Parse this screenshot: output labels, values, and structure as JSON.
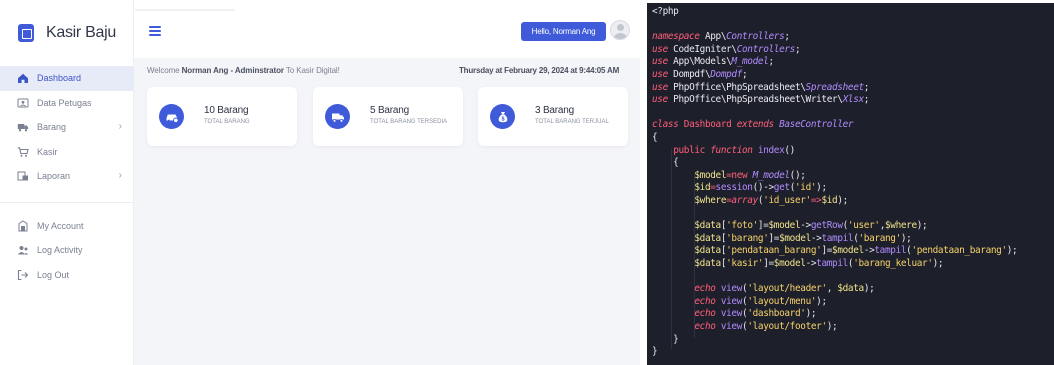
{
  "app": {
    "brand": "Kasir Baju",
    "nav_main": [
      {
        "label": "Dashboard",
        "icon": "home-icon",
        "active": true,
        "has_chevron": false
      },
      {
        "label": "Data Petugas",
        "icon": "users-folder-icon",
        "active": false,
        "has_chevron": false
      },
      {
        "label": "Barang",
        "icon": "truck-icon",
        "active": false,
        "has_chevron": true
      },
      {
        "label": "Kasir",
        "icon": "cart-icon",
        "active": false,
        "has_chevron": false
      },
      {
        "label": "Laporan",
        "icon": "report-icon",
        "active": false,
        "has_chevron": true
      }
    ],
    "nav_account": [
      {
        "label": "My Account",
        "icon": "account-icon"
      },
      {
        "label": "Log Activity",
        "icon": "activity-icon"
      },
      {
        "label": "Log Out",
        "icon": "logout-icon"
      }
    ],
    "chevron": "›",
    "header": {
      "hello": "Hello, Norman Ang"
    },
    "welcome": {
      "prefix": "Welcome ",
      "name": "Norman Ang - Adminstrator",
      "suffix": " To Kasir Digital!"
    },
    "datetime": "Thursday at February 29, 2024 at 9:44:05 AM",
    "cards": [
      {
        "value": "10 Barang",
        "label": "TOTAL BARANG",
        "icon": "car-icon"
      },
      {
        "value": "5 Barang",
        "label": "TOTAL BARANG TERSEDIA",
        "icon": "truck-icon"
      },
      {
        "value": "3 Barang",
        "label": "TOTAL BARANG TERJUAL",
        "icon": "money-bag-icon"
      }
    ],
    "accent_color": "#3f5bd9"
  },
  "code": {
    "colors": {
      "background": "#1d1f2a",
      "keyword": "#ff5f7a",
      "class_ref": "#b28cff",
      "string": "#f7d36b",
      "variable": "#f1e58e",
      "function": "#b28cff",
      "plain": "#e9e9ef"
    },
    "lines": [
      [
        [
          "<?php",
          "plain"
        ]
      ],
      [],
      [
        [
          "namespace",
          "kwi"
        ],
        [
          " App\\",
          "plain"
        ],
        [
          "Controllers",
          "cls"
        ],
        [
          ";",
          "plain"
        ]
      ],
      [
        [
          "use",
          "kwi"
        ],
        [
          " CodeIgniter\\",
          "plain"
        ],
        [
          "Controllers",
          "cls"
        ],
        [
          ";",
          "plain"
        ]
      ],
      [
        [
          "use",
          "kwi"
        ],
        [
          " App\\Models\\",
          "plain"
        ],
        [
          "M_model",
          "cls"
        ],
        [
          ";",
          "plain"
        ]
      ],
      [
        [
          "use",
          "kwi"
        ],
        [
          " Dompdf\\",
          "plain"
        ],
        [
          "Dompdf",
          "cls"
        ],
        [
          ";",
          "plain"
        ]
      ],
      [
        [
          "use",
          "kwi"
        ],
        [
          " PhpOffice\\PhpSpreadsheet\\",
          "plain"
        ],
        [
          "Spreadsheet",
          "cls"
        ],
        [
          ";",
          "plain"
        ]
      ],
      [
        [
          "use",
          "kwi"
        ],
        [
          " PhpOffice\\PhpSpreadsheet\\Writer\\",
          "plain"
        ],
        [
          "Xlsx",
          "cls"
        ],
        [
          ";",
          "plain"
        ]
      ],
      [],
      [
        [
          "class",
          "kwi"
        ],
        [
          " Dashboard ",
          "kw"
        ],
        [
          "extends",
          "kwi"
        ],
        [
          " BaseController",
          "cls"
        ]
      ],
      [
        [
          "{",
          "plain"
        ]
      ],
      [
        [
          "    ",
          "plain"
        ],
        [
          "public",
          "kw"
        ],
        [
          " ",
          "plain"
        ],
        [
          "function",
          "kwi"
        ],
        [
          " index",
          "fn"
        ],
        [
          "()",
          "plain"
        ]
      ],
      [
        [
          "    {",
          "plain"
        ]
      ],
      [
        [
          "        ",
          "plain"
        ],
        [
          "$model",
          "var"
        ],
        [
          "=",
          "op"
        ],
        [
          "new",
          "kw"
        ],
        [
          " ",
          "plain"
        ],
        [
          "M_model",
          "cls"
        ],
        [
          "();",
          "plain"
        ]
      ],
      [
        [
          "        ",
          "plain"
        ],
        [
          "$id",
          "var"
        ],
        [
          "=",
          "op"
        ],
        [
          "session",
          "fn"
        ],
        [
          "()->",
          "plain"
        ],
        [
          "get",
          "fn"
        ],
        [
          "(",
          "plain"
        ],
        [
          "'id'",
          "str"
        ],
        [
          ");",
          "plain"
        ]
      ],
      [
        [
          "        ",
          "plain"
        ],
        [
          "$where",
          "var"
        ],
        [
          "=",
          "op"
        ],
        [
          "array",
          "kwi"
        ],
        [
          "(",
          "plain"
        ],
        [
          "'id_user'",
          "str"
        ],
        [
          "=>",
          "op"
        ],
        [
          "$id",
          "var"
        ],
        [
          ");",
          "plain"
        ]
      ],
      [],
      [
        [
          "        ",
          "plain"
        ],
        [
          "$data",
          "var"
        ],
        [
          "[",
          "plain"
        ],
        [
          "'foto'",
          "str"
        ],
        [
          "]=",
          "plain"
        ],
        [
          "$model",
          "var"
        ],
        [
          "->",
          "plain"
        ],
        [
          "getRow",
          "fn"
        ],
        [
          "(",
          "plain"
        ],
        [
          "'user'",
          "str"
        ],
        [
          ",",
          "plain"
        ],
        [
          "$where",
          "var"
        ],
        [
          ");",
          "plain"
        ]
      ],
      [
        [
          "        ",
          "plain"
        ],
        [
          "$data",
          "var"
        ],
        [
          "[",
          "plain"
        ],
        [
          "'barang'",
          "str"
        ],
        [
          "]=",
          "plain"
        ],
        [
          "$model",
          "var"
        ],
        [
          "->",
          "plain"
        ],
        [
          "tampil",
          "fn"
        ],
        [
          "(",
          "plain"
        ],
        [
          "'barang'",
          "str"
        ],
        [
          ");",
          "plain"
        ]
      ],
      [
        [
          "        ",
          "plain"
        ],
        [
          "$data",
          "var"
        ],
        [
          "[",
          "plain"
        ],
        [
          "'pendataan_barang'",
          "str"
        ],
        [
          "]=",
          "plain"
        ],
        [
          "$model",
          "var"
        ],
        [
          "->",
          "plain"
        ],
        [
          "tampil",
          "fn"
        ],
        [
          "(",
          "plain"
        ],
        [
          "'pendataan_barang'",
          "str"
        ],
        [
          ");",
          "plain"
        ]
      ],
      [
        [
          "        ",
          "plain"
        ],
        [
          "$data",
          "var"
        ],
        [
          "[",
          "plain"
        ],
        [
          "'kasir'",
          "str"
        ],
        [
          "]=",
          "plain"
        ],
        [
          "$model",
          "var"
        ],
        [
          "->",
          "plain"
        ],
        [
          "tampil",
          "fn"
        ],
        [
          "(",
          "plain"
        ],
        [
          "'barang_keluar'",
          "str"
        ],
        [
          ");",
          "plain"
        ]
      ],
      [],
      [
        [
          "        ",
          "plain"
        ],
        [
          "echo",
          "kwi"
        ],
        [
          " ",
          "plain"
        ],
        [
          "view",
          "fn"
        ],
        [
          "(",
          "plain"
        ],
        [
          "'layout/header'",
          "str"
        ],
        [
          ", ",
          "plain"
        ],
        [
          "$data",
          "var"
        ],
        [
          ");",
          "plain"
        ]
      ],
      [
        [
          "        ",
          "plain"
        ],
        [
          "echo",
          "kwi"
        ],
        [
          " ",
          "plain"
        ],
        [
          "view",
          "fn"
        ],
        [
          "(",
          "plain"
        ],
        [
          "'layout/menu'",
          "str"
        ],
        [
          ");",
          "plain"
        ]
      ],
      [
        [
          "        ",
          "plain"
        ],
        [
          "echo",
          "kwi"
        ],
        [
          " ",
          "plain"
        ],
        [
          "view",
          "fn"
        ],
        [
          "(",
          "plain"
        ],
        [
          "'dashboard'",
          "str"
        ],
        [
          ");",
          "plain"
        ]
      ],
      [
        [
          "        ",
          "plain"
        ],
        [
          "echo",
          "kwi"
        ],
        [
          " ",
          "plain"
        ],
        [
          "view",
          "fn"
        ],
        [
          "(",
          "plain"
        ],
        [
          "'layout/footer'",
          "str"
        ],
        [
          ");",
          "plain"
        ]
      ],
      [
        [
          "    }",
          "plain"
        ]
      ],
      [
        [
          "}",
          "plain"
        ]
      ]
    ]
  }
}
